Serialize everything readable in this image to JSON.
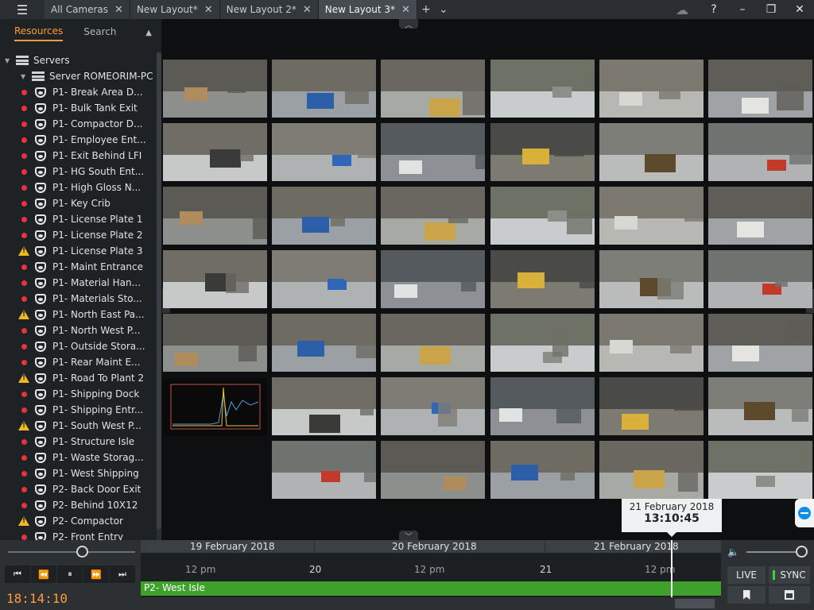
{
  "tabs": [
    {
      "label": "All Cameras",
      "active": false
    },
    {
      "label": "New Layout*",
      "active": false
    },
    {
      "label": "New Layout 2*",
      "active": false
    },
    {
      "label": "New Layout 3*",
      "active": true
    }
  ],
  "window_buttons": {
    "help": "?",
    "minimize": "–",
    "restore": "❐",
    "close": "✕"
  },
  "panel": {
    "tab_resources": "Resources",
    "tab_search": "Search"
  },
  "tree": {
    "root": "Servers",
    "server": "Server ROMEORIM-PC",
    "cameras": [
      {
        "label": "P1- Break Area D...",
        "status": "error"
      },
      {
        "label": "P1- Bulk Tank Exit",
        "status": "error"
      },
      {
        "label": "P1- Compactor D...",
        "status": "error"
      },
      {
        "label": "P1- Employee Ent...",
        "status": "error"
      },
      {
        "label": "P1- Exit Behind LFI",
        "status": "error"
      },
      {
        "label": "P1- HG South Ent...",
        "status": "error"
      },
      {
        "label": "P1- High Gloss N...",
        "status": "error"
      },
      {
        "label": "P1- Key Crib",
        "status": "error"
      },
      {
        "label": "P1- License Plate 1",
        "status": "error"
      },
      {
        "label": "P1- License Plate 2",
        "status": "error"
      },
      {
        "label": "P1- License Plate 3",
        "status": "warning"
      },
      {
        "label": "P1- Maint Entrance",
        "status": "error"
      },
      {
        "label": "P1- Material Han...",
        "status": "error"
      },
      {
        "label": "P1- Materials Sto...",
        "status": "error"
      },
      {
        "label": "P1- North East Pa...",
        "status": "warning"
      },
      {
        "label": "P1- North West P...",
        "status": "error"
      },
      {
        "label": "P1- Outside Stora...",
        "status": "error"
      },
      {
        "label": "P1- Rear Maint E...",
        "status": "error"
      },
      {
        "label": "P1- Road To Plant 2",
        "status": "warning"
      },
      {
        "label": "P1- Shipping Dock",
        "status": "error"
      },
      {
        "label": "P1- Shipping Entr...",
        "status": "error"
      },
      {
        "label": "P1- South West P...",
        "status": "warning"
      },
      {
        "label": "P1- Structure Isle",
        "status": "error"
      },
      {
        "label": "P1- Waste Storag...",
        "status": "error"
      },
      {
        "label": "P1- West Shipping",
        "status": "error"
      },
      {
        "label": "P2- Back Door Exit",
        "status": "error"
      },
      {
        "label": "P2- Behind 10X12",
        "status": "error"
      },
      {
        "label": "P2- Compactor",
        "status": "warning"
      },
      {
        "label": "P2- Front Entry",
        "status": "error"
      }
    ]
  },
  "tooltip": {
    "date": "21 February 2018",
    "time": "13:10:45"
  },
  "playback": {
    "time": "18:14:10",
    "slider_fraction": 0.58
  },
  "timeline": {
    "dates": [
      "19 February 2018",
      "20 February 2018",
      "21 February 2018"
    ],
    "ticks": [
      "12 pm",
      "20",
      "12 pm",
      "21",
      "12 pm"
    ],
    "track_label": "P2- West Isle"
  },
  "controls": {
    "live": "LIVE",
    "sync": "SYNC"
  },
  "colors": {
    "accent": "#ff9a3c",
    "track": "#3fa12b",
    "error": "#e8323c",
    "warning": "#f4b81c"
  }
}
